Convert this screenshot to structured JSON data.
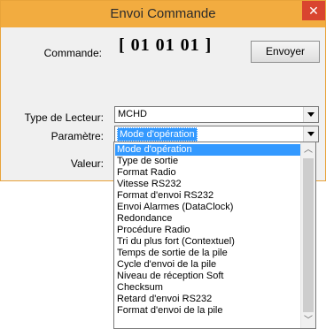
{
  "window": {
    "title": "Envoi Commande",
    "close_glyph": "✕"
  },
  "command": {
    "label": "Commande:",
    "value": "[ 01 01 01 ]",
    "send_label": "Envoyer"
  },
  "reader_type": {
    "label": "Type de Lecteur:",
    "value": "MCHD"
  },
  "parameter": {
    "label": "Paramètre:",
    "value": "Mode d'opération",
    "options": [
      "Mode d'opération",
      "Type de sortie",
      "Format Radio",
      "Vitesse RS232",
      "Format d'envoi RS232",
      "Envoi Alarmes (DataClock)",
      "Redondance",
      "Procédure Radio",
      "Tri du plus fort (Contextuel)",
      "Temps de sortie de la pile",
      "Cycle d'envoi de la pile",
      "Niveau de réception Soft",
      "Checksum",
      "Retard d'envoi RS232",
      "Format d'envoi de la pile"
    ],
    "selected_index": 0
  },
  "value_field": {
    "label": "Valeur:"
  },
  "icons": {
    "dropdown_arrow": "chevron-down-icon",
    "scroll_up": "scroll-up-icon",
    "scroll_down": "scroll-down-icon"
  },
  "colors": {
    "titlebar": "#f2ac40",
    "close_button": "#d9452f",
    "selection": "#3399ff"
  }
}
